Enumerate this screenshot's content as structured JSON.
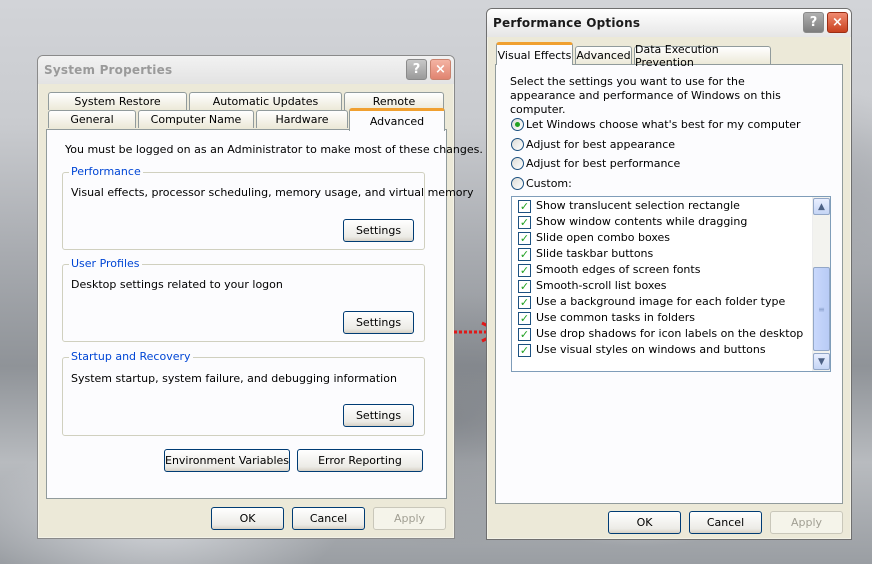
{
  "system_properties": {
    "title": "System Properties",
    "tabs_row1": [
      "System Restore",
      "Automatic Updates",
      "Remote"
    ],
    "tabs_row2": [
      "General",
      "Computer Name",
      "Hardware",
      "Advanced"
    ],
    "admin_note": "You must be logged on as an Administrator to make most of these changes.",
    "performance": {
      "label": "Performance",
      "description": "Visual effects, processor scheduling, memory usage, and virtual memory",
      "button": "Settings"
    },
    "user_profiles": {
      "label": "User Profiles",
      "description": "Desktop settings related to your logon",
      "button": "Settings"
    },
    "startup_recovery": {
      "label": "Startup and Recovery",
      "description": "System startup, system failure, and debugging information",
      "button": "Settings"
    },
    "env_vars_button": "Environment Variables",
    "error_reporting_button": "Error Reporting",
    "ok": "OK",
    "cancel": "Cancel",
    "apply": "Apply"
  },
  "performance_options": {
    "title": "Performance Options",
    "tabs": [
      "Visual Effects",
      "Advanced",
      "Data Execution Prevention"
    ],
    "intro": "Select the settings you want to use for the appearance and performance of Windows on this computer.",
    "radios": [
      {
        "label": "Let Windows choose what's best for my computer",
        "checked": true
      },
      {
        "label": "Adjust for best appearance",
        "checked": false
      },
      {
        "label": "Adjust for best performance",
        "checked": false
      },
      {
        "label": "Custom:",
        "checked": false
      }
    ],
    "effects": [
      "Show translucent selection rectangle",
      "Show window contents while dragging",
      "Slide open combo boxes",
      "Slide taskbar buttons",
      "Smooth edges of screen fonts",
      "Smooth-scroll list boxes",
      "Use a background image for each folder type",
      "Use common tasks in folders",
      "Use drop shadows for icon labels on the desktop",
      "Use visual styles on windows and buttons"
    ],
    "ok": "OK",
    "cancel": "Cancel",
    "apply": "Apply"
  },
  "icons": {
    "help": "?",
    "close": "×",
    "check": "✓",
    "scroll_up": "▲",
    "scroll_down": "▼",
    "grip": "≡"
  },
  "colors": {
    "group_label": "#0046d5",
    "selected_tab_accent": "#f0a030",
    "arrow": "#e01818",
    "check": "#21a121"
  }
}
